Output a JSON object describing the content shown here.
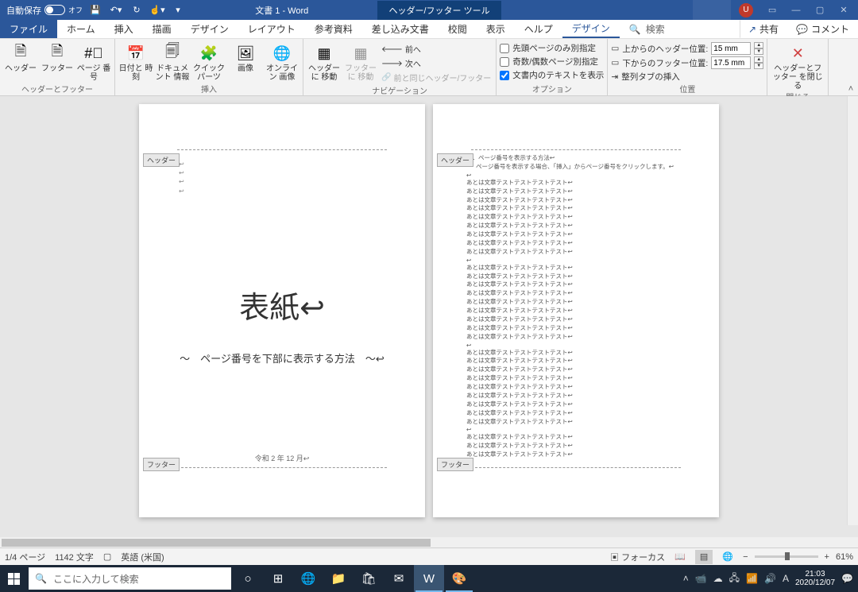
{
  "titlebar": {
    "autosave_label": "自動保存",
    "autosave_state": "オフ",
    "doc_title": "文書 1  -  Word",
    "tool_tab": "ヘッダー/フッター ツール",
    "user_initial": "U"
  },
  "tabs": {
    "file": "ファイル",
    "home": "ホーム",
    "insert": "挿入",
    "draw": "描画",
    "design": "デザイン",
    "layout": "レイアウト",
    "references": "参考資料",
    "mailings": "差し込み文書",
    "review": "校閲",
    "view": "表示",
    "help": "ヘルプ",
    "hf_design": "デザイン",
    "search": "検索",
    "share": "共有",
    "comment": "コメント"
  },
  "ribbon": {
    "g1": {
      "header": "ヘッダー",
      "footer": "フッター",
      "pagenum": "ページ\n番号",
      "title": "ヘッダーとフッター"
    },
    "g2": {
      "datetime": "日付と\n時刻",
      "docinfo": "ドキュメント\n情報",
      "quickparts": "クイック パーツ",
      "picture": "画像",
      "online": "オンライン\n画像",
      "title": "挿入"
    },
    "g3": {
      "goheader": "ヘッダーに\n移動",
      "gofooter": "フッターに\n移動",
      "prev": "前へ",
      "next": "次へ",
      "linkprev": "前と同じヘッダー/フッター",
      "title": "ナビゲーション"
    },
    "g4": {
      "first": "先頭ページのみ別指定",
      "oddeven": "奇数/偶数ページ別指定",
      "showtext": "文書内のテキストを表示",
      "title": "オプション"
    },
    "g5": {
      "fromtop": "上からのヘッダー位置:",
      "frombot": "下からのフッター位置:",
      "topval": "15 mm",
      "botval": "17.5 mm",
      "aligntab": "整列タブの挿入",
      "title": "位置"
    },
    "g6": {
      "close": "ヘッダーとフッター\nを閉じる",
      "title": "閉じる"
    }
  },
  "doc": {
    "header_tag": "ヘッダー",
    "footer_tag": "フッター",
    "cover_title": "表紙↩",
    "cover_sub": "～　ページ番号を下部に表示する方法　～↩",
    "cover_date": "令和 2 年 12 月↩",
    "p2_h1": "１．ページ番号を表示する方法↩",
    "p2_h2": "ページ番号を表示する場合、「挿入」からページ番号をクリックします。↩",
    "line": "あとは文章テストテストテストテスト↩"
  },
  "status": {
    "page": "1/4 ページ",
    "words": "1142 文字",
    "lang": "英語 (米国)",
    "focus": "フォーカス",
    "zoom": "61%"
  },
  "taskbar": {
    "search_placeholder": "ここに入力して検索",
    "time": "21:03",
    "date": "2020/12/07",
    "ime": "A"
  }
}
